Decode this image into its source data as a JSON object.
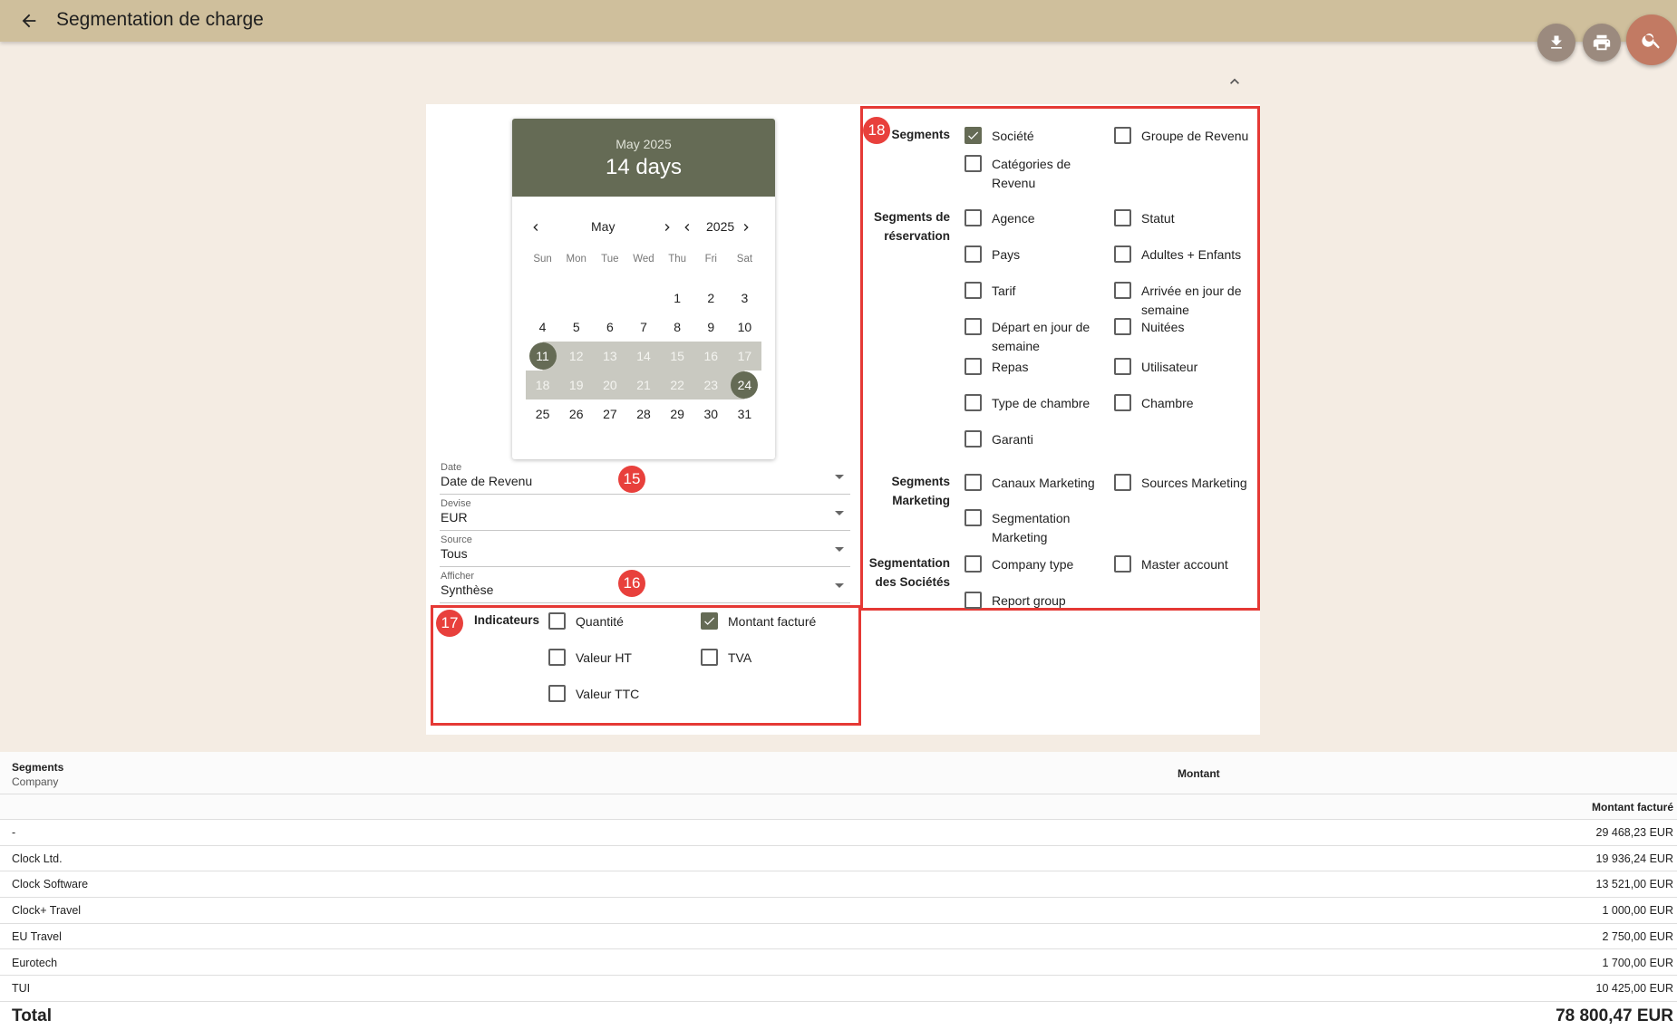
{
  "header": {
    "title": "Segmentation de charge"
  },
  "calendar": {
    "header_month": "May 2025",
    "header_duration": "14 days",
    "month": "May",
    "year": "2025",
    "weekdays": [
      "Sun",
      "Mon",
      "Tue",
      "Wed",
      "Thu",
      "Fri",
      "Sat"
    ],
    "days": [
      "1",
      "2",
      "3",
      "4",
      "5",
      "6",
      "7",
      "8",
      "9",
      "10",
      "11",
      "12",
      "13",
      "14",
      "15",
      "16",
      "17",
      "18",
      "19",
      "20",
      "21",
      "22",
      "23",
      "24",
      "25",
      "26",
      "27",
      "28",
      "29",
      "30",
      "31"
    ]
  },
  "filters": {
    "date": {
      "label": "Date",
      "value": "Date de Revenu"
    },
    "devise": {
      "label": "Devise",
      "value": "EUR"
    },
    "source": {
      "label": "Source",
      "value": "Tous"
    },
    "afficher": {
      "label": "Afficher",
      "value": "Synthèse"
    }
  },
  "badges": {
    "b15": "15",
    "b16": "16",
    "b17": "17",
    "b18": "18"
  },
  "indicateurs": {
    "label": "Indicateurs",
    "items": [
      {
        "label": "Quantité",
        "checked": false
      },
      {
        "label": "Montant facturé",
        "checked": true
      },
      {
        "label": "Valeur HT",
        "checked": false
      },
      {
        "label": "TVA",
        "checked": false
      },
      {
        "label": "Valeur TTC",
        "checked": false
      }
    ]
  },
  "segments": {
    "groups": [
      {
        "label": "Segments",
        "items": [
          {
            "label": "Société",
            "checked": true
          },
          {
            "label": "Groupe de Revenu",
            "checked": false
          },
          {
            "label": "Catégories de Revenu",
            "checked": false
          }
        ]
      },
      {
        "label": "Segments de réservation",
        "items": [
          {
            "label": "Agence",
            "checked": false
          },
          {
            "label": "Statut",
            "checked": false
          },
          {
            "label": "Pays",
            "checked": false
          },
          {
            "label": "Adultes + Enfants",
            "checked": false
          },
          {
            "label": "Tarif",
            "checked": false
          },
          {
            "label": "Arrivée en jour de semaine",
            "checked": false
          },
          {
            "label": "Départ en jour de semaine",
            "checked": false
          },
          {
            "label": "Nuitées",
            "checked": false
          },
          {
            "label": "Repas",
            "checked": false
          },
          {
            "label": "Utilisateur",
            "checked": false
          },
          {
            "label": "Type de chambre",
            "checked": false
          },
          {
            "label": "Chambre",
            "checked": false
          },
          {
            "label": "Garanti",
            "checked": false
          }
        ]
      },
      {
        "label": "Segments Marketing",
        "items": [
          {
            "label": "Canaux Marketing",
            "checked": false
          },
          {
            "label": "Sources Marketing",
            "checked": false
          },
          {
            "label": "Segmentation Marketing",
            "checked": false
          }
        ]
      },
      {
        "label": "Segmentation des Sociétés",
        "items": [
          {
            "label": "Company type",
            "checked": false
          },
          {
            "label": "Master account",
            "checked": false
          },
          {
            "label": "Report group",
            "checked": false
          }
        ]
      }
    ]
  },
  "table": {
    "segments_header": "Segments",
    "segments_sub": "Company",
    "montant_header": "Montant",
    "montant_sub": "Montant facturé",
    "rows": [
      {
        "name": "-",
        "value": "29 468,23 EUR"
      },
      {
        "name": "Clock Ltd.",
        "value": "19 936,24 EUR"
      },
      {
        "name": "Clock Software",
        "value": "13 521,00 EUR"
      },
      {
        "name": "Clock+ Travel",
        "value": "1 000,00 EUR"
      },
      {
        "name": "EU Travel",
        "value": "2 750,00 EUR"
      },
      {
        "name": "Eurotech",
        "value": "1 700,00 EUR"
      },
      {
        "name": "TUI",
        "value": "10 425,00 EUR"
      }
    ],
    "total_label": "Total",
    "total_value": "78 800,47 EUR"
  },
  "icons": {
    "back": "arrow-left-icon",
    "download": "download-icon",
    "print": "printer-icon",
    "search": "search-icon",
    "collapse": "chevron-up-icon"
  },
  "colors": {
    "topbar": "#cfbf9c",
    "page_bg": "#f4ece3",
    "calendar_accent": "#656b55",
    "search_fab": "#c27a63",
    "badge_red": "#e8403c"
  }
}
